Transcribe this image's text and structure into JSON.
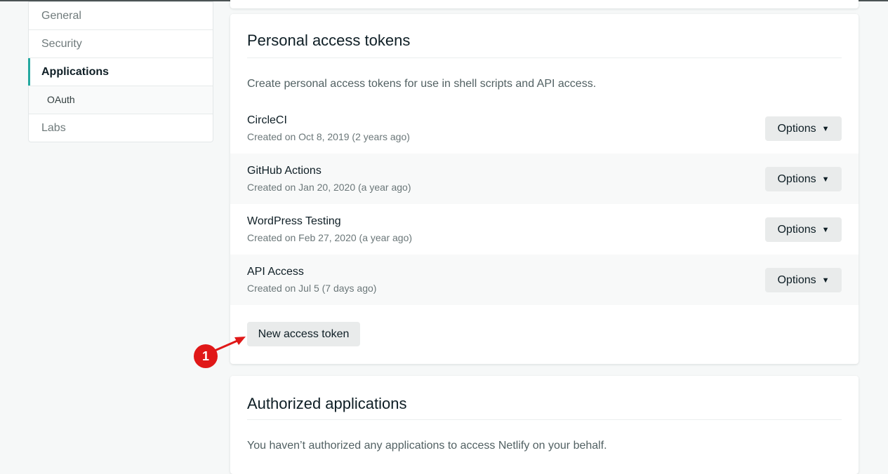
{
  "sidebar": {
    "items": [
      {
        "label": "General"
      },
      {
        "label": "Security"
      },
      {
        "label": "Applications"
      },
      {
        "label": "OAuth"
      },
      {
        "label": "Labs"
      }
    ]
  },
  "tokens_card": {
    "title": "Personal access tokens",
    "description": "Create personal access tokens for use in shell scripts and API access.",
    "tokens": [
      {
        "name": "CircleCI",
        "meta": "Created on Oct 8, 2019 (2 years ago)",
        "options_label": "Options"
      },
      {
        "name": "GitHub Actions",
        "meta": "Created on Jan 20, 2020 (a year ago)",
        "options_label": "Options"
      },
      {
        "name": "WordPress Testing",
        "meta": "Created on Feb 27, 2020 (a year ago)",
        "options_label": "Options"
      },
      {
        "name": "API Access",
        "meta": "Created on Jul 5 (7 days ago)",
        "options_label": "Options"
      }
    ],
    "new_button_label": "New access token"
  },
  "auth_card": {
    "title": "Authorized applications",
    "description": "You haven’t authorized any applications to access Netlify on your behalf."
  },
  "annotation": {
    "step_label": "1",
    "color": "#e01818"
  },
  "colors": {
    "accent": "#24a9a0",
    "page_background": "#f6f8f8",
    "button_background": "#e9ebeb"
  },
  "icons": {
    "options_chevron": "chevron-down-icon",
    "annotation_arrow": "arrow-icon"
  }
}
